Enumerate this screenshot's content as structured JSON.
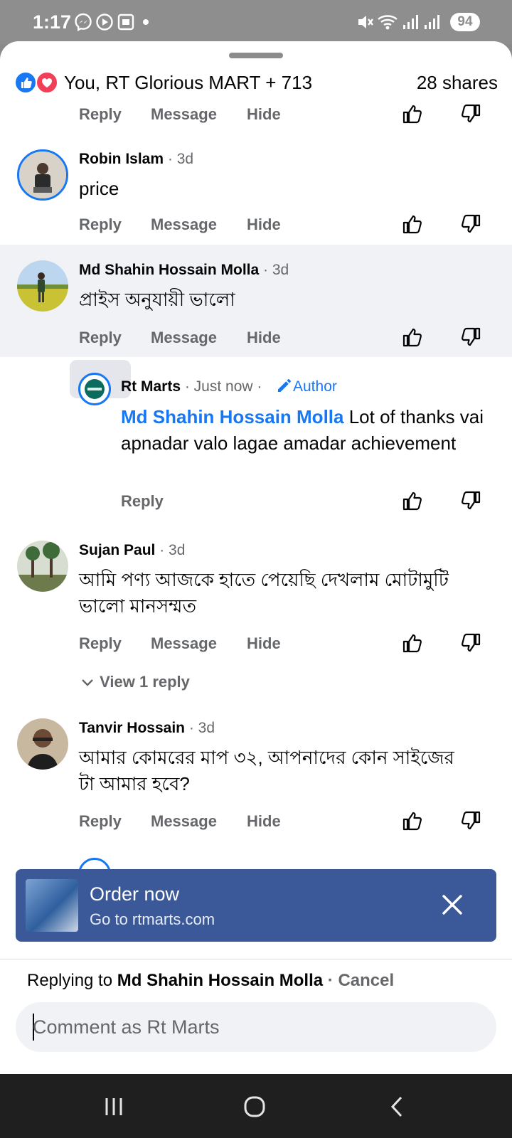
{
  "status_bar": {
    "time": "1:17",
    "battery": "94"
  },
  "reactions": {
    "names": "You, RT Glorious MART + 713",
    "shares": "28 shares"
  },
  "actions": {
    "reply": "Reply",
    "message": "Message",
    "hide": "Hide"
  },
  "comments": [
    {
      "name": "Robin Islam",
      "time": " · 3d",
      "text": "price"
    },
    {
      "name": "Md Shahin Hossain Molla",
      "time": " · 3d",
      "text": "প্রাইস অনুযায়ী ভালো"
    },
    {
      "name": "Sujan Paul",
      "time": " · 3d",
      "text": "আমি পণ্য আজকে হাতে পেয়েছি দেখলাম মোটামুটি ভালো মানসম্মত"
    },
    {
      "name": "Tanvir Hossain",
      "time": " · 3d",
      "text": "আমার কোমরের মাপ ৩২, আপনাদের কোন সাইজের টা আমার হবে?"
    }
  ],
  "reply": {
    "name": "Rt Marts",
    "time": " · Just now ·",
    "author_badge": "Author",
    "mention": "Md Shahin Hossain Molla",
    "text": " Lot of thanks vai apnadar valo lagae amadar achievement"
  },
  "view_replies": "View 1 reply",
  "banner": {
    "title": "Order now",
    "subtitle": "Go to rtmarts.com"
  },
  "composer": {
    "replying_prefix": "Replying to ",
    "replying_to": "Md Shahin Hossain Molla",
    "separator": " · ",
    "cancel": "Cancel",
    "placeholder": "Comment as Rt Marts"
  },
  "colors": {
    "facebook_blue": "#1877f2",
    "banner_blue": "#3b5998",
    "highlight_bg": "#f0f2f5",
    "muted_text": "#65676b"
  }
}
